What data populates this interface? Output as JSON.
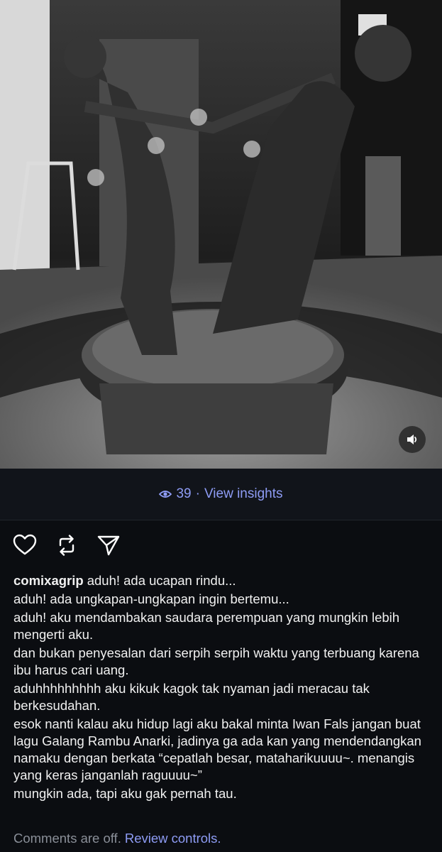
{
  "post": {
    "username": "comixagrip",
    "views": "39",
    "separator": "·",
    "insights_label": "View insights",
    "caption_first": "aduh! ada ucapan rindu...",
    "caption_lines": [
      "aduh! ada ungkapan-ungkapan ingin bertemu...",
      "aduh! aku mendambakan saudara perempuan yang mungkin lebih mengerti aku.",
      "dan bukan penyesalan dari serpih serpih waktu yang terbuang karena ibu harus cari uang.",
      "aduhhhhhhhhh aku kikuk kagok tak nyaman jadi meracau tak berkesudahan.",
      "esok nanti kalau aku hidup lagi aku bakal minta Iwan Fals jangan buat lagu Galang Rambu Anarki, jadinya ga ada kan yang mendendangkan namaku dengan berkata “cepatlah besar, mataharikuuuu~. menangis yang keras janganlah raguuuu~”",
      "mungkin ada, tapi aku gak pernah tau."
    ],
    "comments_off": "Comments are off.",
    "review_controls": "Review controls."
  },
  "icons": {
    "like": "heart-icon",
    "repost": "repost-icon",
    "share": "send-icon",
    "views": "eye-icon",
    "mute": "speaker-icon"
  },
  "colors": {
    "background": "#0b0d11",
    "accent": "#8e9cf5",
    "muted": "#8a8f98"
  }
}
